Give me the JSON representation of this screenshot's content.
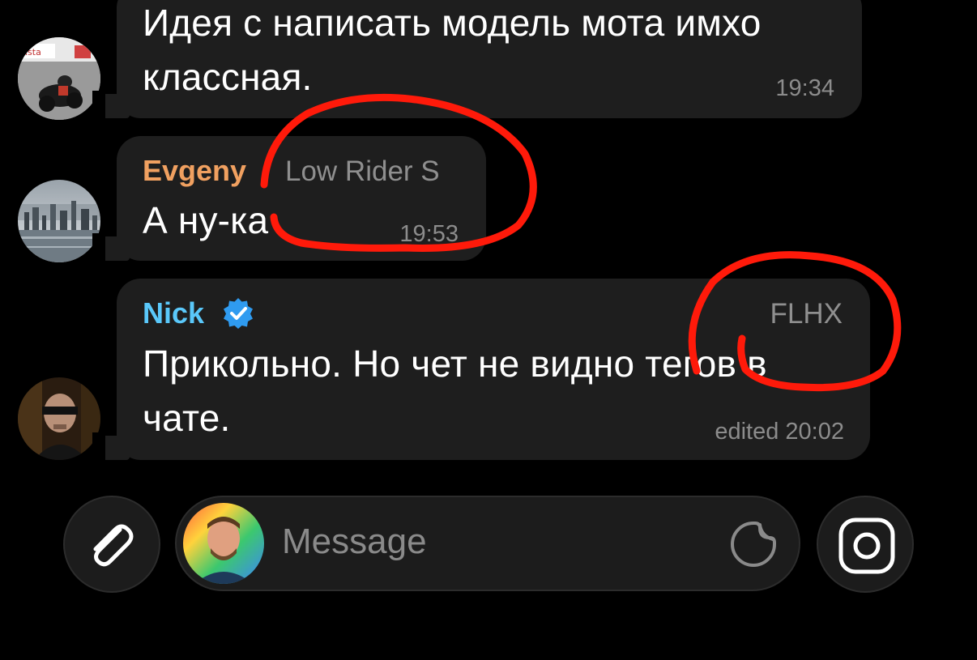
{
  "messages": [
    {
      "id": "msg-1",
      "text_line1": "Идея с написать модель мота имхо",
      "text_line2": "классная.",
      "time": "19:34"
    },
    {
      "id": "msg-2",
      "sender": "Evgeny",
      "sender_color": "#f0a060",
      "tag": "Low Rider S",
      "text": "А ну-ка",
      "time": "19:53"
    },
    {
      "id": "msg-3",
      "sender": "Nick",
      "sender_color": "#5ac8fa",
      "verified_icon": "verified-badge-icon",
      "tag": "FLHX",
      "text_line1": "Прикольно. Но чет не видно тегов в",
      "text_line2": "чате.",
      "time": "edited 20:02"
    }
  ],
  "composer": {
    "attach_icon": "paperclip-icon",
    "placeholder": "Message",
    "sticker_icon": "sticker-icon",
    "camera_icon": "camera-icon"
  },
  "colors": {
    "background": "#000000",
    "bubble": "#1e1e1e",
    "annotation": "#ff1a0a"
  }
}
